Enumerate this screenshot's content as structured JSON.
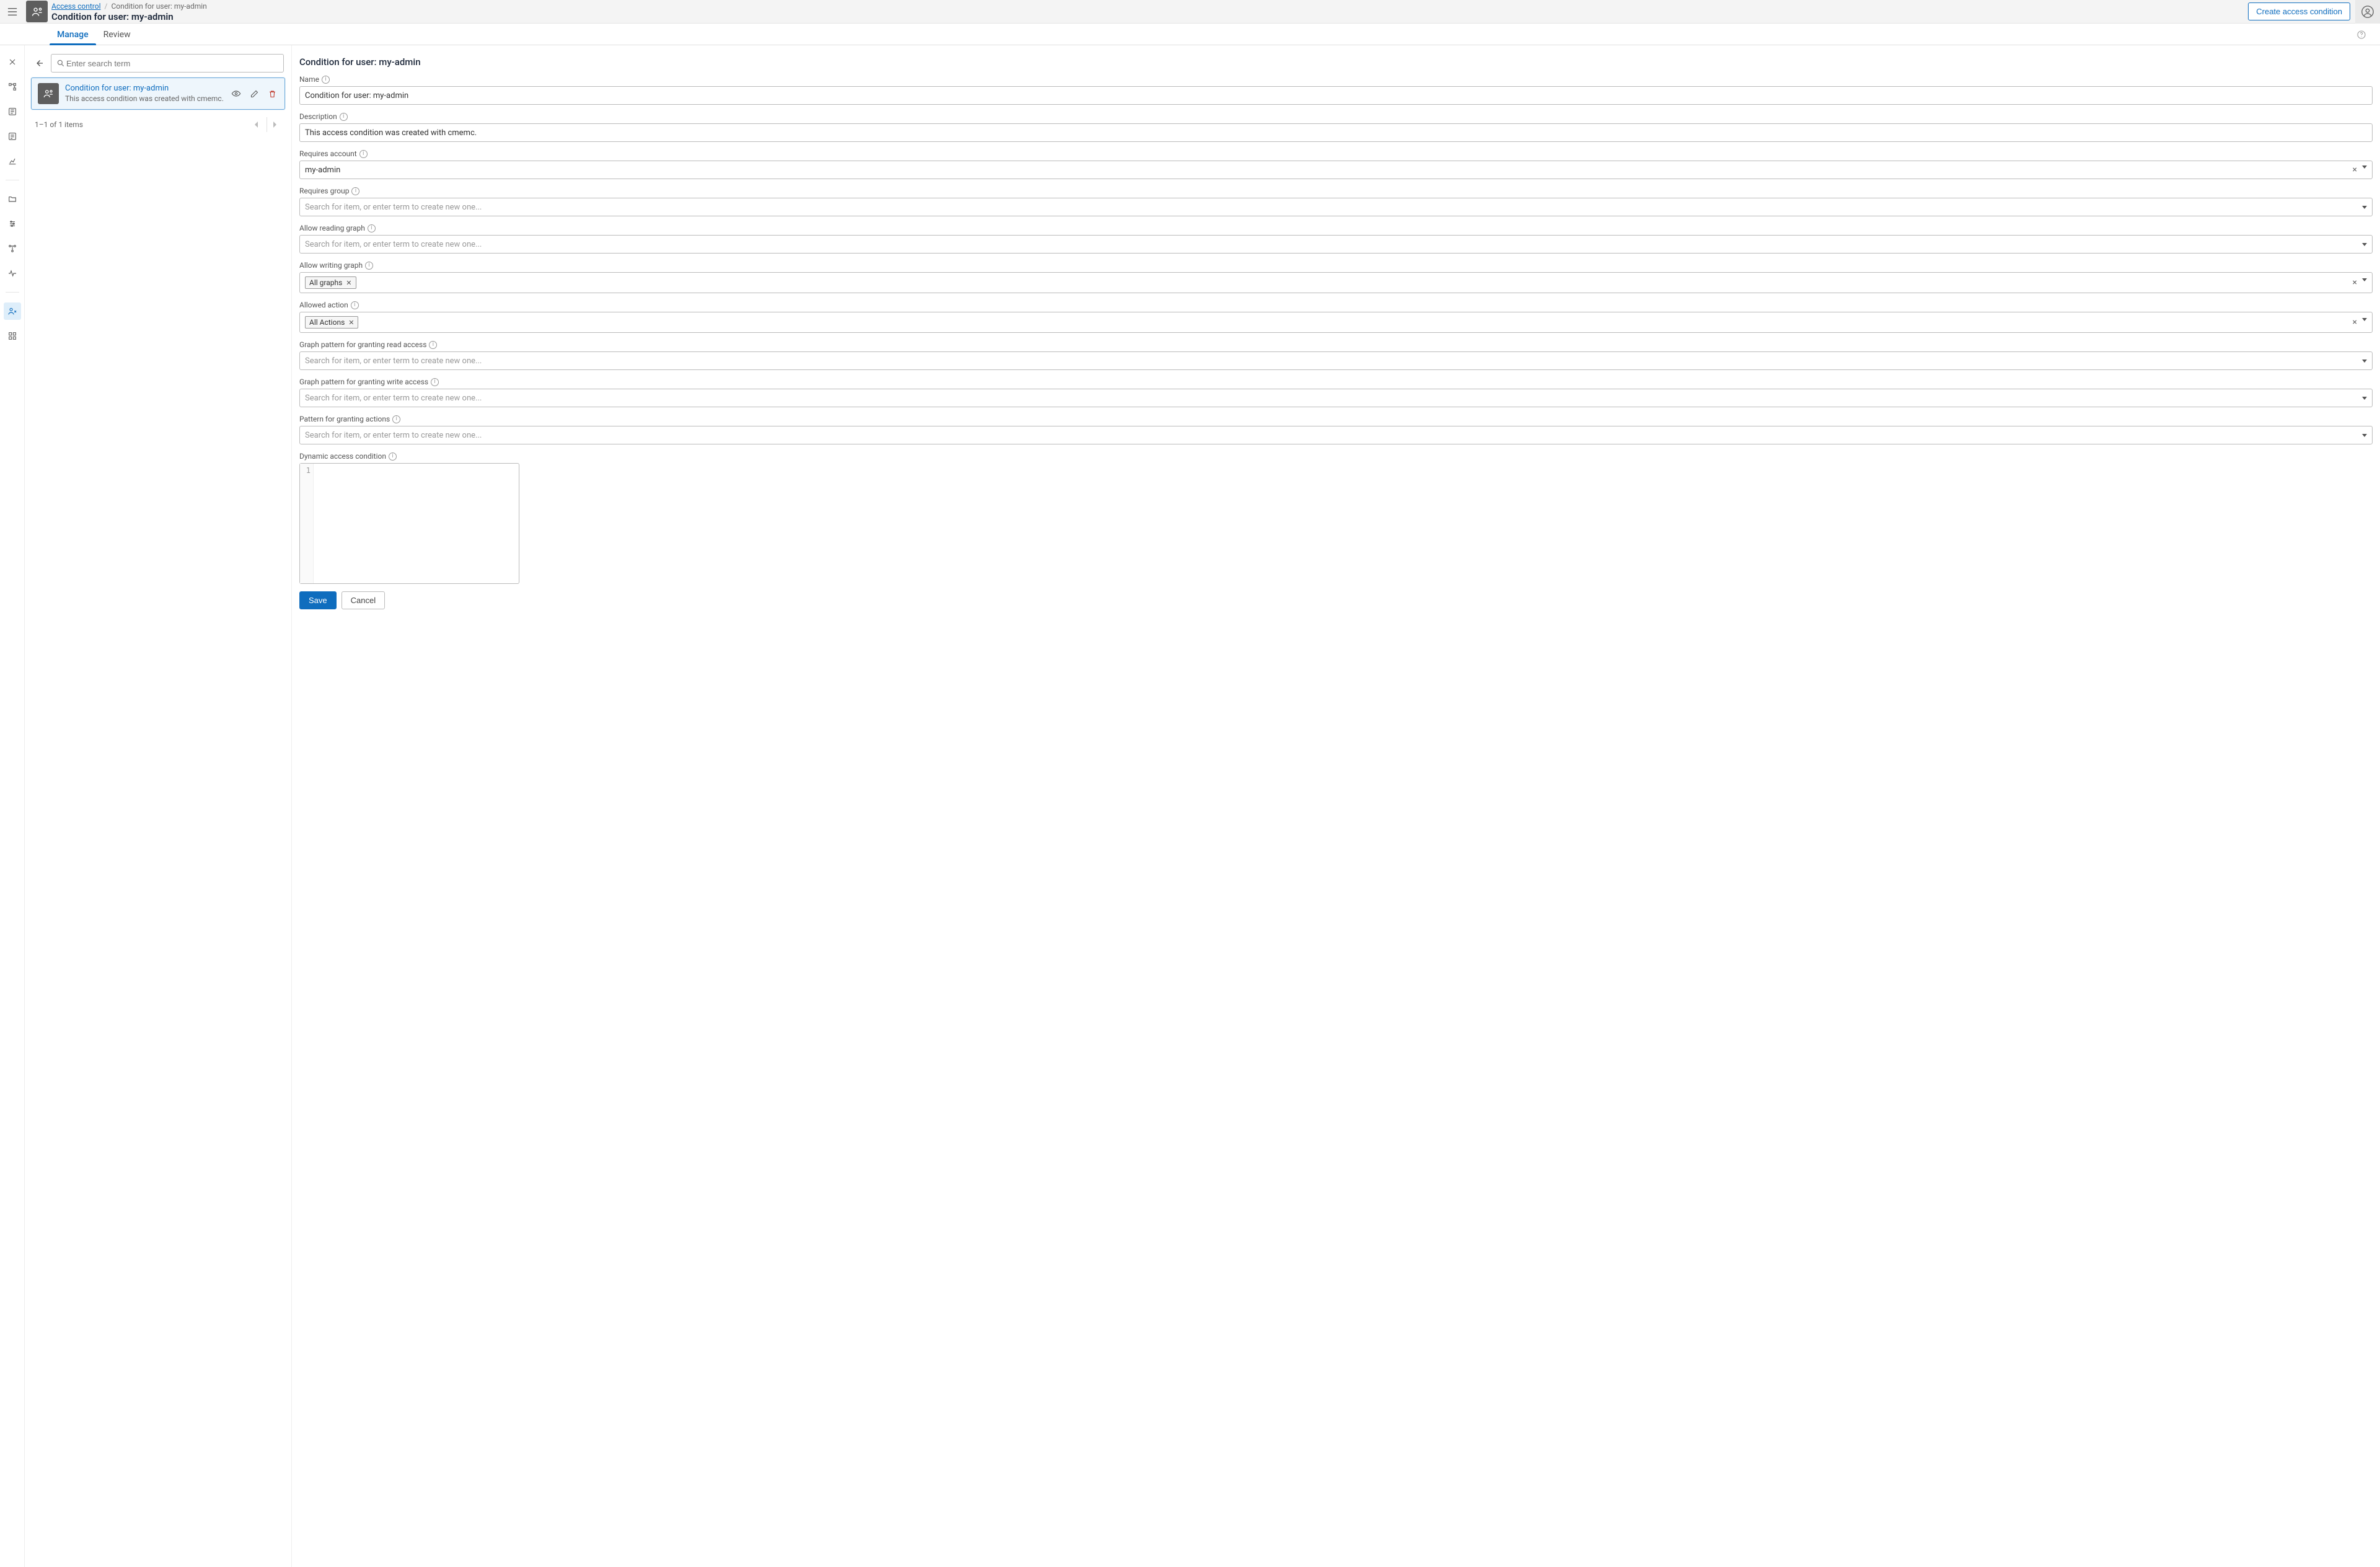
{
  "header": {
    "breadcrumb_root": "Access control",
    "breadcrumb_current": "Condition for user: my-admin",
    "page_title": "Condition for user: my-admin",
    "create_button": "Create access condition"
  },
  "tabs": {
    "manage": "Manage",
    "review": "Review"
  },
  "left": {
    "search_placeholder": "Enter search term",
    "card_title": "Condition for user: my-admin",
    "card_sub": "This access condition was created with cmemc.",
    "pager_text": "1–1 of 1 items"
  },
  "panel": {
    "title": "Condition for user: my-admin",
    "fields": {
      "name_label": "Name",
      "name_value": "Condition for user: my-admin",
      "desc_label": "Description",
      "desc_value": "This access condition was created with cmemc.",
      "req_acct_label": "Requires account",
      "req_acct_value": "my-admin",
      "req_group_label": "Requires group",
      "allow_read_label": "Allow reading graph",
      "allow_write_label": "Allow writing graph",
      "allow_write_chip": "All graphs",
      "allowed_action_label": "Allowed action",
      "allowed_action_chip": "All Actions",
      "pat_read_label": "Graph pattern for granting read access",
      "pat_write_label": "Graph pattern for granting write access",
      "pat_actions_label": "Pattern for granting actions",
      "dyn_label": "Dynamic access condition",
      "search_ph": "Search for item, or enter term to create new one...",
      "code_line": "1",
      "save": "Save",
      "cancel": "Cancel"
    }
  }
}
